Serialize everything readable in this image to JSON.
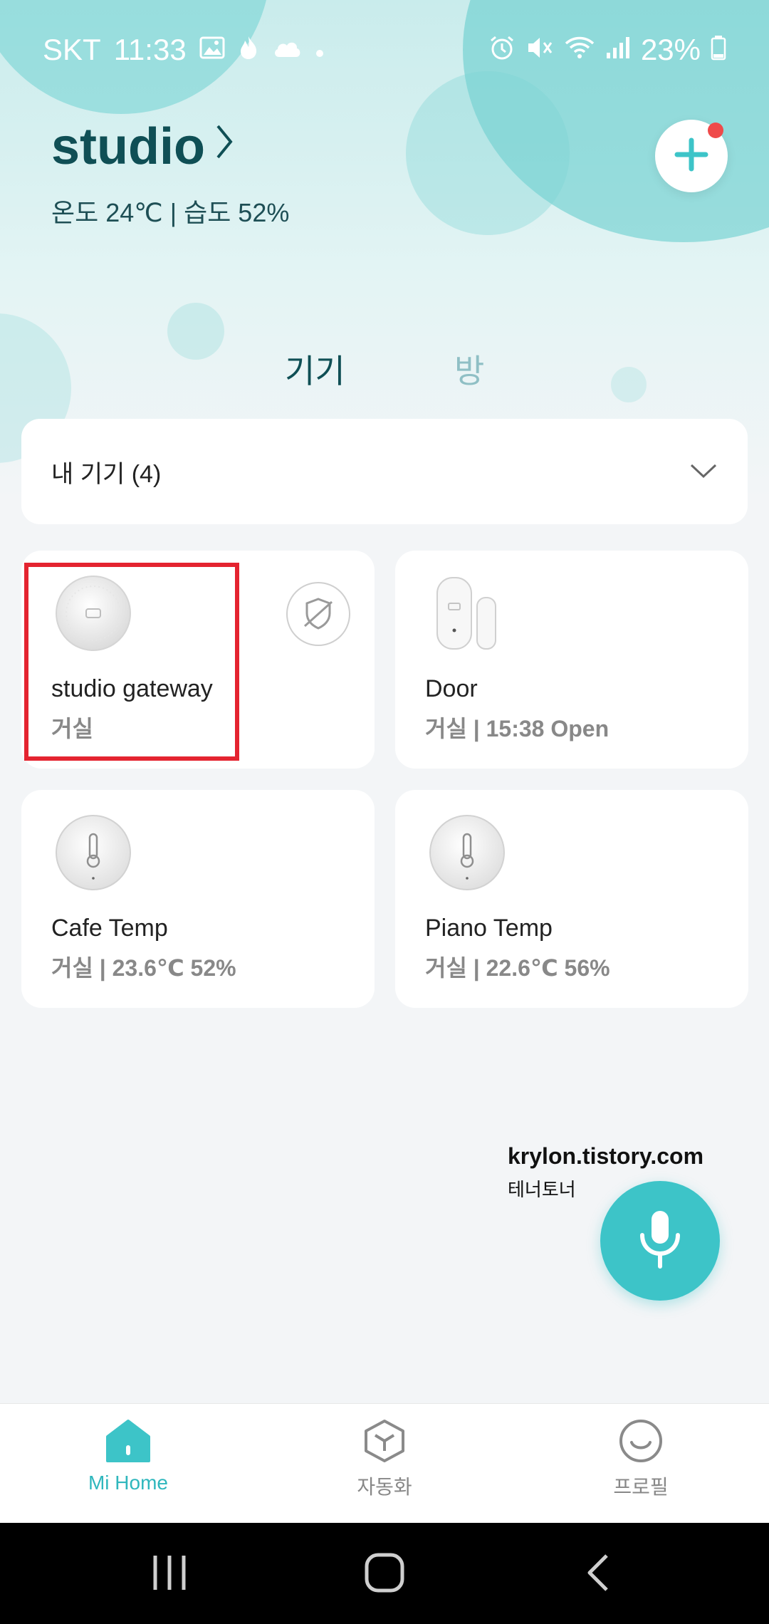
{
  "status_bar": {
    "carrier": "SKT",
    "time": "11:33",
    "battery": "23%"
  },
  "home": {
    "name": "studio",
    "climate": "온도 24℃ | 습도 52%"
  },
  "tabs": [
    {
      "label": "기기",
      "active": true
    },
    {
      "label": "방",
      "active": false
    }
  ],
  "device_group": {
    "label": "내 기기 (4)"
  },
  "devices": [
    {
      "name": "studio gateway",
      "sub": "거실",
      "icon": "gateway-icon",
      "offline": true
    },
    {
      "name": "Door",
      "sub": "거실 | 15:38 Open",
      "icon": "door-sensor-icon"
    },
    {
      "name": "Cafe Temp",
      "sub": "거실 | 23.6℃ 52%",
      "icon": "thermometer-icon"
    },
    {
      "name": "Piano Temp",
      "sub": "거실 | 22.6℃ 56%",
      "icon": "thermometer-icon"
    }
  ],
  "watermark": {
    "line1": "krylon.tistory.com",
    "line2": "테너토너"
  },
  "bottom_nav": [
    {
      "label": "Mi Home",
      "icon": "home-icon",
      "active": true
    },
    {
      "label": "자동화",
      "icon": "automation-icon",
      "active": false
    },
    {
      "label": "프로필",
      "icon": "profile-icon",
      "active": false
    }
  ],
  "colors": {
    "accent": "#3dc4c8",
    "title": "#0f4f55",
    "highlight": "#e42430",
    "notification": "#ef4a4a"
  }
}
